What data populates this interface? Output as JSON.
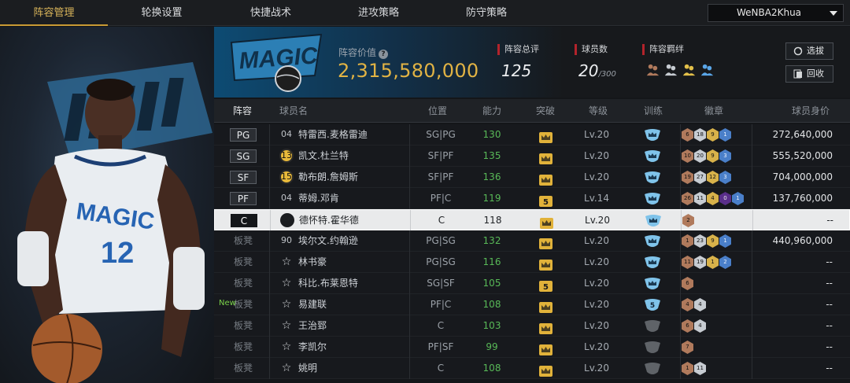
{
  "nav": {
    "tabs": [
      "阵容管理",
      "轮换设置",
      "快捷战术",
      "进攻策略",
      "防守策略"
    ],
    "active_tab": 0,
    "user_select": "WeNBA2Khua"
  },
  "header": {
    "value_label": "阵容价值",
    "value": "2,315,580,000",
    "overall_label": "阵容总评",
    "overall": "125",
    "count_label": "球员数",
    "count": "20",
    "count_max": "/300",
    "chem_label": "阵容羁绊",
    "btn_select": "选拔",
    "btn_recycle": "回收"
  },
  "table": {
    "headers": [
      "阵容",
      "球员名",
      "位置",
      "能力",
      "突破",
      "等级",
      "训练",
      "徽章",
      "球员身价"
    ],
    "rows": [
      {
        "slot": "PG",
        "bench": false,
        "jersey": "04",
        "jtype": "plain",
        "name": "特雷西.麦格雷迪",
        "pos": "SG|PG",
        "ability": "130",
        "brk": "crown",
        "level": "Lv.20",
        "train": "crown",
        "badges": [
          {
            "t": "6",
            "c": "bronze"
          },
          {
            "t": "18",
            "c": "silver"
          },
          {
            "t": "9",
            "c": "gold"
          },
          {
            "t": "1",
            "c": "blue"
          }
        ],
        "price": "272,640,000"
      },
      {
        "slot": "SG",
        "bench": false,
        "jersey": "13",
        "jtype": "gold",
        "name": "凯文.杜兰特",
        "pos": "SF|PF",
        "ability": "135",
        "brk": "crown",
        "level": "Lv.20",
        "train": "crown",
        "badges": [
          {
            "t": "10",
            "c": "bronze"
          },
          {
            "t": "20",
            "c": "silver"
          },
          {
            "t": "9",
            "c": "gold"
          },
          {
            "t": "3",
            "c": "blue"
          }
        ],
        "price": "555,520,000"
      },
      {
        "slot": "SF",
        "bench": false,
        "jersey": "15",
        "jtype": "gold",
        "name": "勒布朗.詹姆斯",
        "pos": "SF|PF",
        "ability": "136",
        "brk": "crown",
        "level": "Lv.20",
        "train": "crown",
        "badges": [
          {
            "t": "19",
            "c": "bronze"
          },
          {
            "t": "27",
            "c": "silver"
          },
          {
            "t": "12",
            "c": "gold"
          },
          {
            "t": "3",
            "c": "blue"
          }
        ],
        "price": "704,000,000"
      },
      {
        "slot": "PF",
        "bench": false,
        "jersey": "04",
        "jtype": "plain",
        "name": "蒂姆.邓肯",
        "pos": "PF|C",
        "ability": "119",
        "brk": "5",
        "level": "Lv.14",
        "train": "crown",
        "badges": [
          {
            "t": "26",
            "c": "bronze"
          },
          {
            "t": "11",
            "c": "silver"
          },
          {
            "t": "4",
            "c": "gold"
          },
          {
            "t": "0",
            "c": "purple"
          },
          {
            "t": "1",
            "c": "blue"
          }
        ],
        "price": "137,760,000"
      },
      {
        "slot": "C",
        "bench": false,
        "selected": true,
        "jersey": "COPY",
        "jtype": "coin",
        "name": "德怀特.霍华德",
        "pos": "C",
        "ability": "118",
        "brk": "crown",
        "level": "Lv.20",
        "train": "crown",
        "badges": [
          {
            "t": "2",
            "c": "bronze"
          }
        ],
        "price": "--"
      },
      {
        "slot": "板凳",
        "bench": true,
        "jersey": "90",
        "jtype": "plain",
        "name": "埃尔文.约翰逊",
        "pos": "PG|SG",
        "ability": "132",
        "brk": "crown",
        "level": "Lv.20",
        "train": "crown",
        "badges": [
          {
            "t": "1",
            "c": "bronze"
          },
          {
            "t": "23",
            "c": "silver"
          },
          {
            "t": "9",
            "c": "gold"
          },
          {
            "t": "1",
            "c": "blue"
          }
        ],
        "price": "440,960,000"
      },
      {
        "slot": "板凳",
        "bench": true,
        "jersey": "☆",
        "jtype": "star",
        "name": "林书豪",
        "pos": "PG|SG",
        "ability": "116",
        "brk": "crown",
        "level": "Lv.20",
        "train": "crown",
        "badges": [
          {
            "t": "11",
            "c": "bronze"
          },
          {
            "t": "19",
            "c": "silver"
          },
          {
            "t": "1",
            "c": "gold"
          },
          {
            "t": "2",
            "c": "blue"
          }
        ],
        "price": "--"
      },
      {
        "slot": "板凳",
        "bench": true,
        "jersey": "☆",
        "jtype": "star",
        "name": "科比.布莱恩特",
        "pos": "SG|SF",
        "ability": "105",
        "brk": "5",
        "level": "Lv.20",
        "train": "crown",
        "badges": [
          {
            "t": "6",
            "c": "bronze"
          }
        ],
        "price": "--"
      },
      {
        "slot": "板凳",
        "bench": true,
        "new": "New",
        "jersey": "☆",
        "jtype": "star",
        "name": "易建联",
        "pos": "PF|C",
        "ability": "108",
        "brk": "crown",
        "level": "Lv.20",
        "train": "5",
        "badges": [
          {
            "t": "4",
            "c": "bronze"
          },
          {
            "t": "4",
            "c": "silver"
          }
        ],
        "price": "--"
      },
      {
        "slot": "板凳",
        "bench": true,
        "jersey": "☆",
        "jtype": "star",
        "name": "王治郅",
        "pos": "C",
        "ability": "103",
        "brk": "crown",
        "level": "Lv.20",
        "train": "grey",
        "badges": [
          {
            "t": "6",
            "c": "bronze"
          },
          {
            "t": "4",
            "c": "silver"
          }
        ],
        "price": "--"
      },
      {
        "slot": "板凳",
        "bench": true,
        "jersey": "☆",
        "jtype": "star",
        "name": "李凯尔",
        "pos": "PF|SF",
        "ability": "99",
        "brk": "crown",
        "level": "Lv.20",
        "train": "grey",
        "badges": [
          {
            "t": "7",
            "c": "bronze"
          }
        ],
        "price": "--"
      },
      {
        "slot": "板凳",
        "bench": true,
        "jersey": "☆",
        "jtype": "star",
        "name": "姚明",
        "pos": "C",
        "ability": "108",
        "brk": "crown",
        "level": "Lv.20",
        "train": "grey",
        "badges": [
          {
            "t": "1",
            "c": "bronze"
          },
          {
            "t": "11",
            "c": "silver"
          }
        ],
        "price": "--"
      }
    ]
  }
}
